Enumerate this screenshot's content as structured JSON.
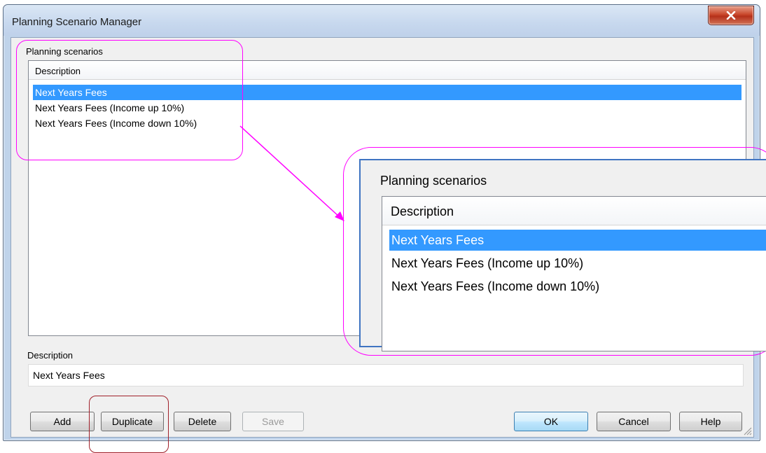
{
  "window": {
    "title": "Planning Scenario Manager",
    "close_icon": "close-icon"
  },
  "scenarios": {
    "group_label": "Planning scenarios",
    "column_header": "Description",
    "rows": [
      "Next Years Fees",
      "Next Years Fees (Income up 10%)",
      "Next Years Fees (Income down 10%)"
    ],
    "selected_index": 0
  },
  "description": {
    "label": "Description",
    "value": "Next Years Fees"
  },
  "buttons": {
    "add": "Add",
    "duplicate": "Duplicate",
    "delete": "Delete",
    "save": "Save",
    "ok": "OK",
    "cancel": "Cancel",
    "help": "Help"
  },
  "colors": {
    "selection": "#3399ff",
    "annotation": "#ff00ff",
    "button_highlight": "#a0202a"
  }
}
